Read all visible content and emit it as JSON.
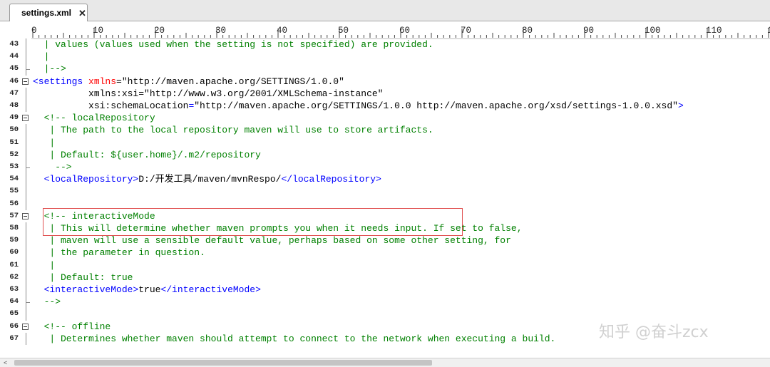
{
  "tab": {
    "title": "settings.xml",
    "close_glyph": "✕"
  },
  "ruler": {
    "labels": [
      "0",
      "10",
      "20",
      "30",
      "40",
      "50",
      "60",
      "70",
      "80",
      "90",
      "100",
      "110",
      "12"
    ]
  },
  "watermark": "知乎 @奋斗zcx",
  "lines": [
    {
      "n": "43",
      "parts": [
        [
          "c-cmt",
          "  | values (values used when the setting is not specified) are provided."
        ]
      ]
    },
    {
      "n": "44",
      "parts": [
        [
          "c-cmt",
          "  |"
        ]
      ]
    },
    {
      "n": "45",
      "parts": [
        [
          "c-cmt",
          "  |-->"
        ]
      ]
    },
    {
      "n": "46",
      "parts": [
        [
          "c-tag",
          "<settings "
        ],
        [
          "c-attr",
          "xmlns"
        ],
        [
          "c-val",
          "=\"http://maven.apache.org/SETTINGS/1.0.0\""
        ]
      ]
    },
    {
      "n": "47",
      "parts": [
        [
          "c-val",
          "          xmlns:xsi=\"http://www.w3.org/2001/XMLSchema-instance\""
        ]
      ]
    },
    {
      "n": "48",
      "parts": [
        [
          "c-val",
          "          xsi:schemaLocation"
        ],
        [
          "c-tag",
          "="
        ],
        [
          "c-val",
          "\"http://maven.apache.org/SETTINGS/1.0.0 http://maven.apache.org/xsd/settings-1.0.0.xsd\""
        ],
        [
          "c-tag",
          ">"
        ]
      ]
    },
    {
      "n": "49",
      "parts": [
        [
          "c-cmt",
          "  <!-- localRepository"
        ]
      ]
    },
    {
      "n": "50",
      "parts": [
        [
          "c-cmt",
          "   | The path to the local repository maven will use to store artifacts."
        ]
      ]
    },
    {
      "n": "51",
      "parts": [
        [
          "c-cmt",
          "   |"
        ]
      ]
    },
    {
      "n": "52",
      "parts": [
        [
          "c-cmt",
          "   | Default: ${user.home}/.m2/repository"
        ]
      ]
    },
    {
      "n": "53",
      "parts": [
        [
          "c-cmt",
          "    -->"
        ]
      ]
    },
    {
      "n": "54",
      "parts": [
        [
          "c-tag",
          "  <localRepository>"
        ],
        [
          "c-text",
          "D:/开发工具/maven/mvnRespo/"
        ],
        [
          "c-tag",
          "</localRepository>"
        ]
      ]
    },
    {
      "n": "55",
      "parts": []
    },
    {
      "n": "56",
      "parts": []
    },
    {
      "n": "57",
      "parts": [
        [
          "c-cmt",
          "  <!-- interactiveMode"
        ]
      ]
    },
    {
      "n": "58",
      "parts": [
        [
          "c-cmt",
          "   | This will determine whether maven prompts you when it needs input. If set to false,"
        ]
      ]
    },
    {
      "n": "59",
      "parts": [
        [
          "c-cmt",
          "   | maven will use a sensible default value, perhaps based on some other setting, for"
        ]
      ]
    },
    {
      "n": "60",
      "parts": [
        [
          "c-cmt",
          "   | the parameter in question."
        ]
      ]
    },
    {
      "n": "61",
      "parts": [
        [
          "c-cmt",
          "   |"
        ]
      ]
    },
    {
      "n": "62",
      "parts": [
        [
          "c-cmt",
          "   | Default: true"
        ]
      ]
    },
    {
      "n": "63",
      "parts": [
        [
          "c-tag",
          "  <interactiveMode>"
        ],
        [
          "c-text",
          "true"
        ],
        [
          "c-tag",
          "</interactiveMode>"
        ]
      ]
    },
    {
      "n": "64",
      "parts": [
        [
          "c-cmt",
          "  -->"
        ]
      ]
    },
    {
      "n": "65",
      "parts": []
    },
    {
      "n": "66",
      "parts": [
        [
          "c-cmt",
          "  <!-- offline"
        ]
      ]
    },
    {
      "n": "67",
      "parts": [
        [
          "c-cmt",
          "   | Determines whether maven should attempt to connect to the network when executing a build."
        ]
      ]
    }
  ]
}
